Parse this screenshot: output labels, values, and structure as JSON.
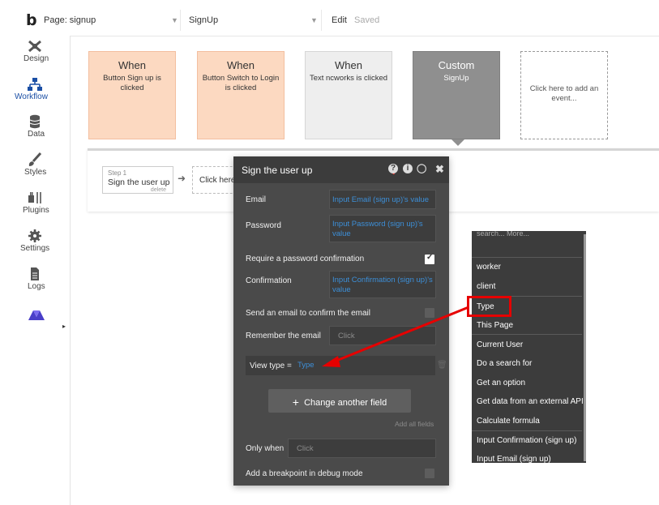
{
  "topbar": {
    "logo": "b",
    "page_label": "Page: signup",
    "element_label": "SignUp",
    "edit_label": "Edit",
    "saved_label": "Saved"
  },
  "sidebar": {
    "items": [
      {
        "label": "Design",
        "icon": "design-icon"
      },
      {
        "label": "Workflow",
        "icon": "workflow-icon",
        "active": true
      },
      {
        "label": "Data",
        "icon": "database-icon"
      },
      {
        "label": "Styles",
        "icon": "brush-icon"
      },
      {
        "label": "Plugins",
        "icon": "plug-icon"
      },
      {
        "label": "Settings",
        "icon": "gear-icon"
      },
      {
        "label": "Logs",
        "icon": "document-icon"
      }
    ]
  },
  "events": [
    {
      "title": "When",
      "subtitle": "Button Sign up is clicked"
    },
    {
      "title": "When",
      "subtitle": "Button Switch to Login is clicked"
    },
    {
      "title": "When",
      "subtitle": "Text ncworks is clicked"
    },
    {
      "title": "Custom",
      "subtitle": "SignUp"
    },
    {
      "title": "",
      "subtitle": "Click here to add an event..."
    }
  ],
  "steps": {
    "step1_number": "Step 1",
    "step1_title": "Sign the user up",
    "step1_delete": "delete",
    "add_step": "Click here to add an action..."
  },
  "panel": {
    "title": "Sign the user up",
    "email_label": "Email",
    "email_value": "Input Email (sign up)'s value",
    "password_label": "Password",
    "password_value": "Input Password (sign up)'s value",
    "require_confirm_label": "Require a password confirmation",
    "require_confirm_checked": true,
    "confirmation_label": "Confirmation",
    "confirmation_value": "Input Confirmation (sign up)'s value",
    "send_email_label": "Send an email to confirm the email",
    "remember_label": "Remember the email",
    "remember_placeholder": "Click",
    "view_type_label": "View type =",
    "view_type_value": "Type",
    "change_button": "Change another field",
    "add_all_fields": "Add all fields",
    "only_when_label": "Only when",
    "only_when_placeholder": "Click",
    "breakpoint_label": "Add a breakpoint in debug mode"
  },
  "dropdown": {
    "top_partial": "search...     More...",
    "items": [
      "worker",
      "client",
      "Type",
      "This Page",
      "Current User",
      "Do a search for",
      "Get an option",
      "Get data from an external API",
      "Calculate formula",
      "Input Confirmation (sign up)",
      "Input Email (sign up)"
    ],
    "highlighted": "Type"
  },
  "colors": {
    "event_orange": "#fcd9c1",
    "event_gray": "#eeeeee",
    "event_custom": "#8f8f8f",
    "accent_blue": "#3d8fd8",
    "annotation_red": "#e60000",
    "panel_bg": "#4a4a4a"
  }
}
